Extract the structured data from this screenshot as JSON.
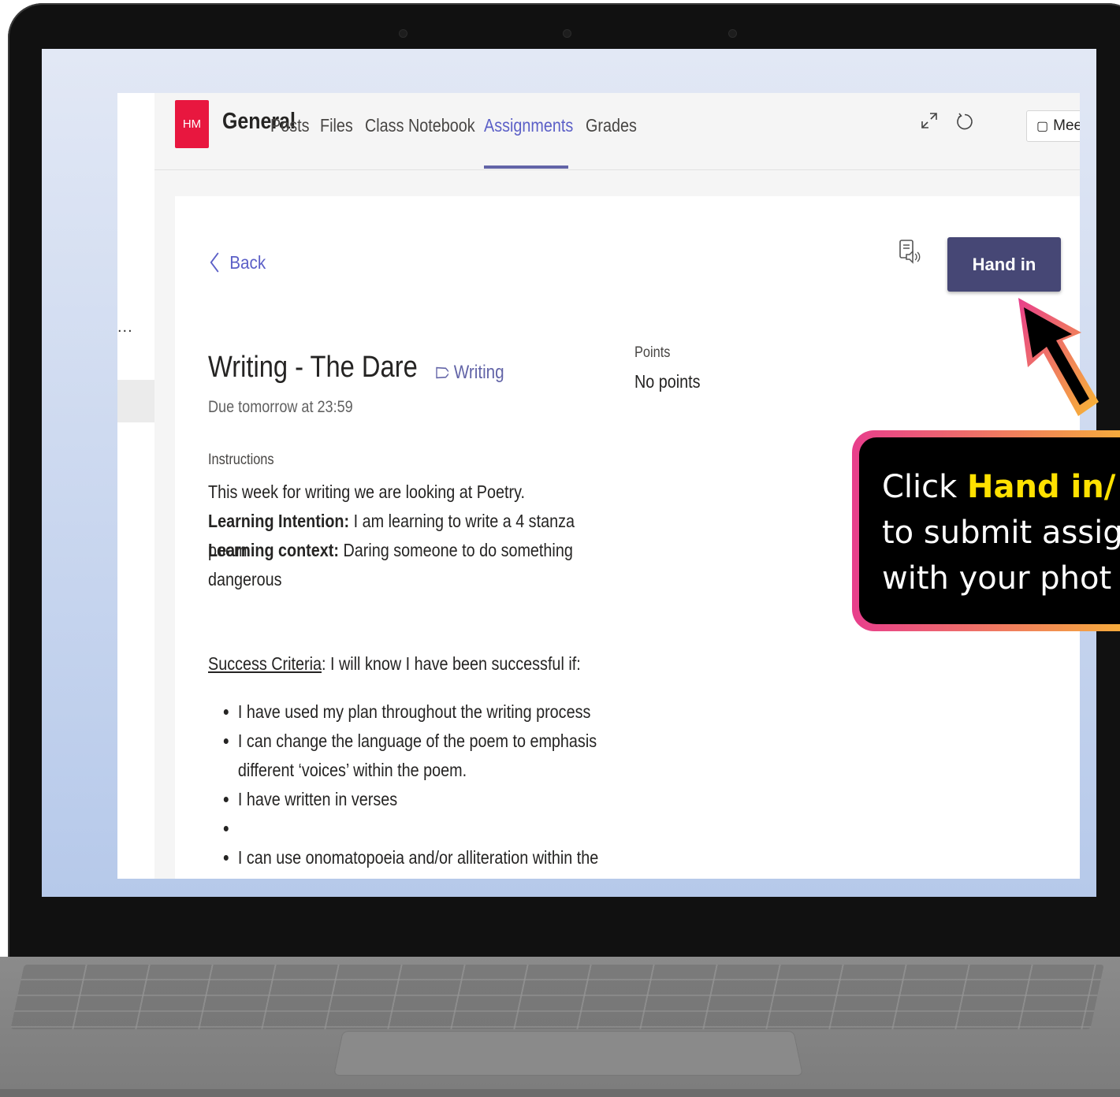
{
  "teams": {
    "avatar_initials": "HM",
    "team_name": "General",
    "tabs": [
      {
        "label": "Posts"
      },
      {
        "label": "Files"
      },
      {
        "label": "Class Notebook"
      },
      {
        "label": "Assignments"
      },
      {
        "label": "Grades"
      }
    ],
    "active_tab": "Assignments",
    "meet_label": "Mee",
    "left_rail_more": "..."
  },
  "assignment": {
    "back_label": "Back",
    "hand_in_label": "Hand in",
    "title": "Writing - The Dare",
    "tag": "Writing",
    "due": "Due tomorrow at 23:59",
    "points_label": "Points",
    "points_value": "No points",
    "instructions_label": "Instructions",
    "line1": "This week for writing we are looking at Poetry.",
    "intention_label": "Learning Intention:",
    "intention_text": " I am learning to write a 4 stanza poem",
    "context_label": "Learning context:",
    "context_text": "  Daring someone to do something dangerous",
    "success_label": "Success Criteria",
    "success_text": ": I will  know I have been successful if:",
    "criteria": [
      "I have used my plan throughout the writing process",
      "I can change the language of the poem to emphasis different ‘voices’ within the poem.",
      "I have written in verses",
      "",
      "I can use onomatopoeia and/or alliteration within the"
    ]
  },
  "callout": {
    "line1_pre": "Click ",
    "line1_highlight": "Hand in/",
    "line2": "to submit assig",
    "line3": "with your phot"
  },
  "colors": {
    "accent": "#6264a7",
    "hand_in_bg": "#464775",
    "avatar_bg": "#e8173f",
    "callout_highlight": "#ffe100"
  }
}
